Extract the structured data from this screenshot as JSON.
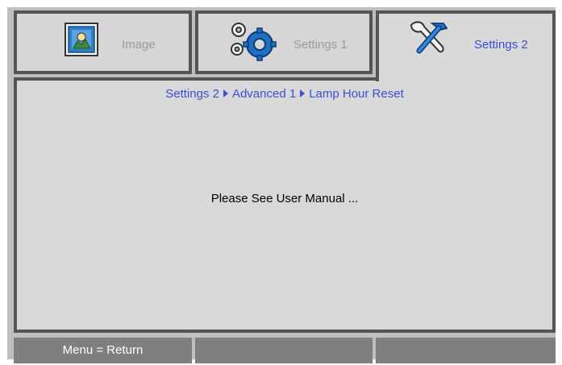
{
  "tabs": [
    {
      "label": "Image",
      "icon": "image-icon",
      "active": false
    },
    {
      "label": "Settings 1",
      "icon": "gears-icon",
      "active": false
    },
    {
      "label": "Settings 2",
      "icon": "tools-icon",
      "active": true
    }
  ],
  "breadcrumb": {
    "items": [
      "Settings 2",
      "Advanced 1",
      "Lamp Hour Reset"
    ],
    "separator_icon": "triangle-right-icon"
  },
  "message": "Please See User Manual ...",
  "footer": {
    "cells": [
      "Menu = Return",
      "",
      ""
    ]
  },
  "colors": {
    "accent": "#3a4fd6",
    "border": "#555555",
    "panel": "#d9d9d9",
    "footer": "#7f7f7f"
  }
}
